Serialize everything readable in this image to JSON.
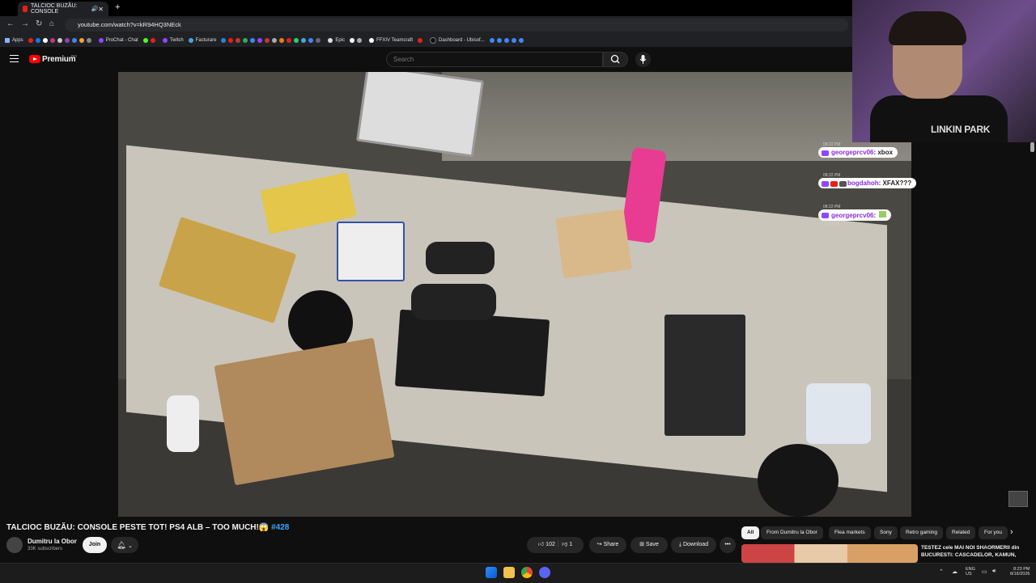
{
  "browser": {
    "tab_title": "TALCIOC BUZĂU: CONSOLE",
    "new_tab": "+",
    "url": "youtube.com/watch?v=kR94HQ3NEck",
    "bookmarks": [
      "Apps",
      "ProChat - Chat",
      "Twitch",
      "Facturare",
      "Epic",
      "FFXIV Teamcraft",
      "Dashboard - Ubisof..."
    ]
  },
  "youtube": {
    "brand": "Premium",
    "region": "RO",
    "search_placeholder": "Search"
  },
  "chat": [
    {
      "time": "08:22 PM",
      "user": "georgeprcv06",
      "text": ": xbox"
    },
    {
      "time": "08:22 PM",
      "user": "bogdahoh",
      "text": ": XFAX???"
    },
    {
      "time": "08:22 PM",
      "user": "georgeprcv06",
      "text": ": "
    }
  ],
  "webcam": {
    "shirt_text": "LINKIN PARK"
  },
  "video": {
    "title": "TALCIOC BUZĂU: CONSOLE PESTE TOT! PS4 ALB – TOO MUCH!😱",
    "hashtag": "#428",
    "channel": "Dumitru la Obor",
    "subscribers": "33K subscribers",
    "join": "Join",
    "likes": "102",
    "dislikes": "1",
    "share": "Share",
    "save": "Save",
    "download": "Download",
    "more": "•••"
  },
  "chips": [
    "All",
    "From Dumitru la Obor",
    "Flea markets",
    "Sony",
    "Retro gaming",
    "Related",
    "For you"
  ],
  "related": {
    "title": "TESTEZ cele MAI NOI SHAORMERII din BUCURESTI: CASCADELOR, KAMUN,"
  },
  "taskbar": {
    "lang": "ENG",
    "lang_region": "US",
    "time": "8:23 PM",
    "date": "8/16/2026"
  }
}
